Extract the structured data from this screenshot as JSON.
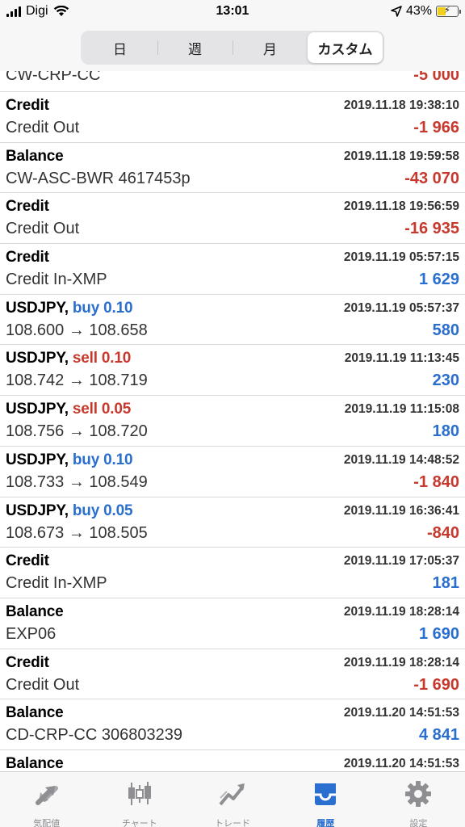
{
  "status": {
    "carrier": "Digi",
    "time": "13:01",
    "battery": "43%",
    "battery_level": 0.43,
    "icons": [
      "signal-icon",
      "wifi-icon",
      "location-arrow-icon",
      "battery-icon"
    ]
  },
  "segments": {
    "items": [
      "日",
      "週",
      "月",
      "カスタム"
    ],
    "selected": "カスタム"
  },
  "partial_top": {
    "detail": "CW-CRP-CC",
    "amount": "-5 000"
  },
  "rows": [
    {
      "type": "Credit",
      "side": "",
      "time": "2019.11.18 19:38:10",
      "detail": "Credit Out",
      "amount": "-1 966",
      "sign": "neg"
    },
    {
      "type": "Balance",
      "side": "",
      "time": "2019.11.18 19:59:58",
      "detail": "CW-ASC-BWR 4617453p",
      "amount": "-43 070",
      "sign": "neg"
    },
    {
      "type": "Credit",
      "side": "",
      "time": "2019.11.18 19:56:59",
      "detail": "Credit Out",
      "amount": "-16 935",
      "sign": "neg"
    },
    {
      "type": "Credit",
      "side": "",
      "time": "2019.11.19 05:57:15",
      "detail": "Credit In-XMP",
      "amount": "1 629",
      "sign": "pos"
    },
    {
      "type": "USDJPY,",
      "side": "buy 0.10",
      "side_kind": "buy",
      "time": "2019.11.19 05:57:37",
      "detail": "108.600 → 108.658",
      "amount": "580",
      "sign": "pos"
    },
    {
      "type": "USDJPY,",
      "side": "sell 0.10",
      "side_kind": "sell",
      "time": "2019.11.19 11:13:45",
      "detail": "108.742 → 108.719",
      "amount": "230",
      "sign": "pos"
    },
    {
      "type": "USDJPY,",
      "side": "sell 0.05",
      "side_kind": "sell",
      "time": "2019.11.19 11:15:08",
      "detail": "108.756 → 108.720",
      "amount": "180",
      "sign": "pos"
    },
    {
      "type": "USDJPY,",
      "side": "buy 0.10",
      "side_kind": "buy",
      "time": "2019.11.19 14:48:52",
      "detail": "108.733 → 108.549",
      "amount": "-1 840",
      "sign": "neg"
    },
    {
      "type": "USDJPY,",
      "side": "buy 0.05",
      "side_kind": "buy",
      "time": "2019.11.19 16:36:41",
      "detail": "108.673 → 108.505",
      "amount": "-840",
      "sign": "neg"
    },
    {
      "type": "Credit",
      "side": "",
      "time": "2019.11.19 17:05:37",
      "detail": "Credit In-XMP",
      "amount": "181",
      "sign": "pos"
    },
    {
      "type": "Balance",
      "side": "",
      "time": "2019.11.19 18:28:14",
      "detail": "EXP06",
      "amount": "1 690",
      "sign": "pos"
    },
    {
      "type": "Credit",
      "side": "",
      "time": "2019.11.19 18:28:14",
      "detail": "Credit Out",
      "amount": "-1 690",
      "sign": "neg"
    },
    {
      "type": "Balance",
      "side": "",
      "time": "2019.11.20 14:51:53",
      "detail": "CD-CRP-CC 306803239",
      "amount": "4 841",
      "sign": "pos"
    },
    {
      "type": "Balance",
      "side": "",
      "time": "2019.11.20 14:51:53",
      "detail": "",
      "amount": "",
      "sign": "pos"
    }
  ],
  "colors": {
    "positive": "#2a6fcf",
    "negative": "#c7392c",
    "active_tab": "#2a6fcf"
  },
  "tabs": [
    {
      "label": "気配値",
      "icon": "quotes-arrows-icon",
      "active": false
    },
    {
      "label": "チャート",
      "icon": "candlestick-chart-icon",
      "active": false
    },
    {
      "label": "トレード",
      "icon": "trade-trend-icon",
      "active": false
    },
    {
      "label": "履歴",
      "icon": "history-inbox-icon",
      "active": true
    },
    {
      "label": "設定",
      "icon": "gear-icon",
      "active": false
    }
  ]
}
